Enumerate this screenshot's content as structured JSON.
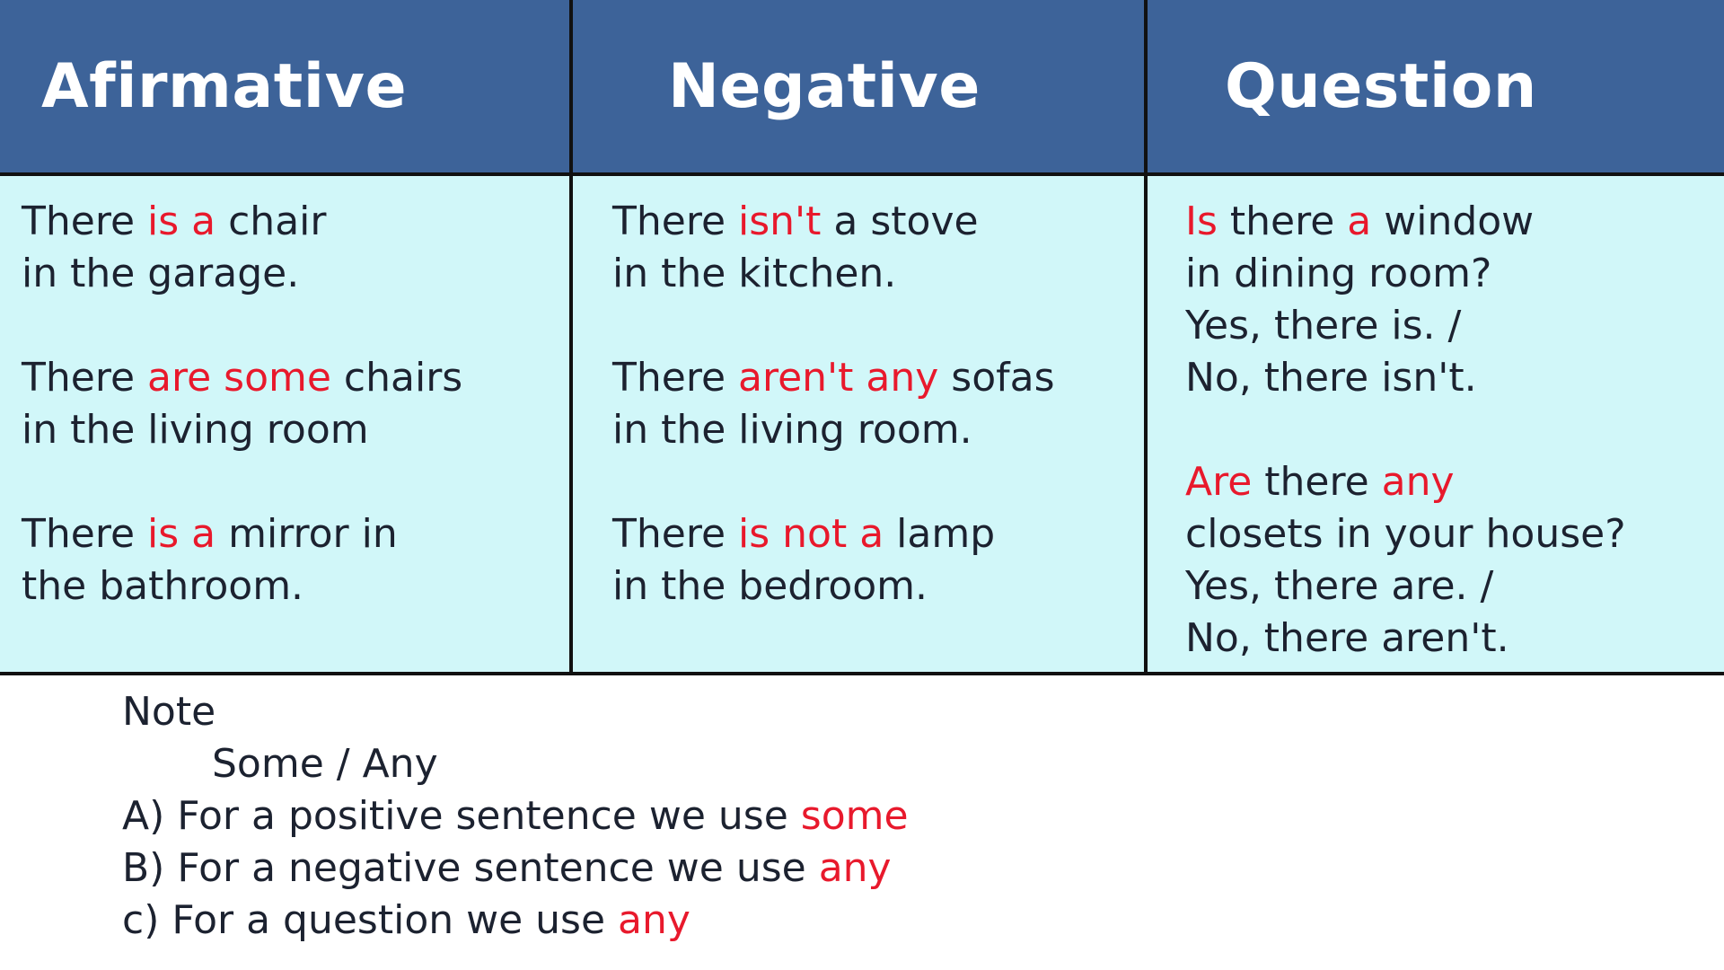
{
  "headers": {
    "affirmative": "Afirmative",
    "negative": "Negative",
    "question": "Question"
  },
  "affirmative": [
    {
      "l1a": "There ",
      "l1b": "is a",
      "l1c": " chair",
      "l2": "in the garage."
    },
    {
      "l1a": "There ",
      "l1b": "are some",
      "l1c": " chairs",
      "l2": "in the living room"
    },
    {
      "l1a": "There ",
      "l1b": "is a",
      "l1c": " mirror in",
      "l2": "the bathroom."
    }
  ],
  "negative": [
    {
      "l1a": "There ",
      "l1b": "isn't",
      "l1c": " a stove",
      "l2": "in the kitchen."
    },
    {
      "l1a": "There ",
      "l1b": "aren't any",
      "l1c": " sofas",
      "l2": "in the living room."
    },
    {
      "l1a": "There ",
      "l1b": "is not a",
      "l1c": " lamp",
      "l2": "in the bedroom."
    }
  ],
  "question": [
    {
      "w1": "Is",
      "w2": " there ",
      "w3": "a",
      "w4": " window",
      "l2": "in dining room?",
      "l3": "Yes, there is. /",
      "l4": "No, there isn't."
    },
    {
      "w1": "Are",
      "w2": " there ",
      "w3": "any",
      "w4": "",
      "l2": "closets in your house?",
      "l3": "Yes, there are. /",
      "l4": "No, there aren't."
    }
  ],
  "note": {
    "title": "Note",
    "subtitle": "Some / Any",
    "rules": [
      {
        "text": "A) For a positive sentence we use ",
        "keyword": "some"
      },
      {
        "text": "B) For a negative sentence we use ",
        "keyword": "any"
      },
      {
        "text": "c) For a question we use ",
        "keyword": "any"
      }
    ]
  },
  "colors": {
    "header_bg": "#3d6399",
    "body_bg": "#d1f7f9",
    "highlight": "#e8192c",
    "text": "#1c2230"
  }
}
